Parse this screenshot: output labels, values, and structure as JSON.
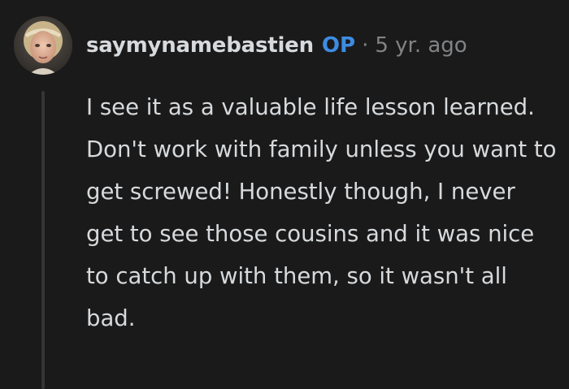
{
  "comment": {
    "author": "saymynamebastien",
    "op_badge": "OP",
    "separator": "·",
    "timestamp": "5 yr. ago",
    "body": "I see it as a valuable life lesson learned. Don't work with family unless you want to get screwed! Honestly though, I never get to see those cousins and it was nice to catch up with them, so it wasn't all bad."
  },
  "colors": {
    "background": "#1a1a1b",
    "text": "#d7dadc",
    "op_badge": "#3d8ce2",
    "muted": "#818384",
    "thread_line": "#343536"
  },
  "icons": {
    "avatar": "user-avatar-portrait"
  }
}
